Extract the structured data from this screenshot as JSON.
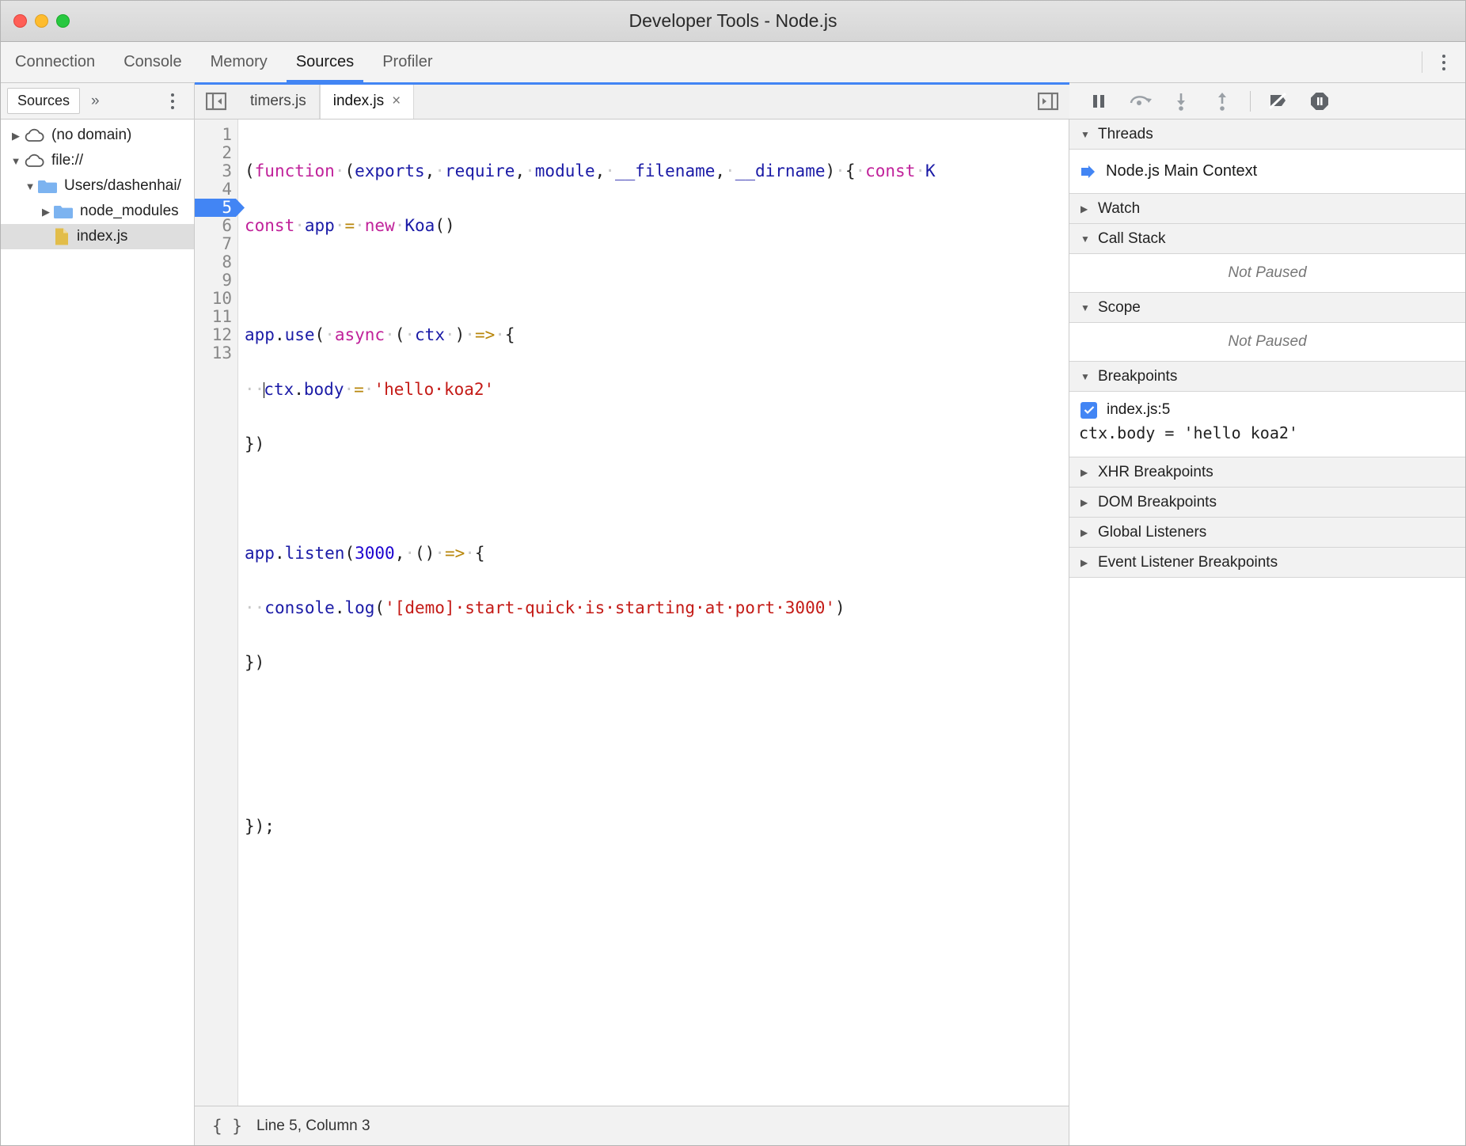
{
  "window": {
    "title": "Developer Tools - Node.js",
    "traffic_lights": [
      "close-red",
      "minimize-yellow",
      "zoom-green"
    ]
  },
  "main_tabs": {
    "items": [
      {
        "label": "Connection",
        "active": false
      },
      {
        "label": "Console",
        "active": false
      },
      {
        "label": "Memory",
        "active": false
      },
      {
        "label": "Sources",
        "active": true
      },
      {
        "label": "Profiler",
        "active": false
      }
    ],
    "more_icon": "kebab-menu-icon"
  },
  "navigator": {
    "tab_label": "Sources",
    "overflow_label": "»",
    "more_icon": "kebab-menu-icon",
    "tree": [
      {
        "label": "(no domain)",
        "icon": "cloud-icon",
        "twisty": "▶",
        "depth": 0,
        "selected": false
      },
      {
        "label": "file://",
        "icon": "cloud-icon",
        "twisty": "▼",
        "depth": 0,
        "selected": false
      },
      {
        "label": "Users/dashenhai/",
        "icon": "folder-icon",
        "twisty": "▼",
        "depth": 1,
        "selected": false
      },
      {
        "label": "node_modules",
        "icon": "folder-icon",
        "twisty": "▶",
        "depth": 2,
        "selected": false
      },
      {
        "label": "index.js",
        "icon": "file-js-icon",
        "twisty": "",
        "depth": 2,
        "selected": true
      }
    ]
  },
  "editor": {
    "show_navigator_icon": "collapse-navigator-icon",
    "show_debugger_icon": "expand-debugger-icon",
    "tabs": [
      {
        "label": "timers.js",
        "active": false,
        "closable": false
      },
      {
        "label": "index.js",
        "active": true,
        "closable": true,
        "close_label": "×"
      }
    ],
    "line_numbers": [
      "1",
      "2",
      "3",
      "4",
      "5",
      "6",
      "7",
      "8",
      "9",
      "10",
      "11",
      "12",
      "13"
    ],
    "breakpoint_line": 5,
    "lines": [
      {
        "n": 1,
        "text": "(function (exports, require, module, __filename, __dirname) { const K"
      },
      {
        "n": 2,
        "text": "const app = new Koa()"
      },
      {
        "n": 3,
        "text": ""
      },
      {
        "n": 4,
        "text": "app.use( async ( ctx ) => {"
      },
      {
        "n": 5,
        "text": "  ctx.body = 'hello koa2'"
      },
      {
        "n": 6,
        "text": "})"
      },
      {
        "n": 7,
        "text": ""
      },
      {
        "n": 8,
        "text": "app.listen(3000, () => {"
      },
      {
        "n": 9,
        "text": "  console.log('[demo] start-quick is starting at port 3000')"
      },
      {
        "n": 10,
        "text": "})"
      },
      {
        "n": 11,
        "text": ""
      },
      {
        "n": 12,
        "text": ""
      },
      {
        "n": 13,
        "text": "});"
      }
    ]
  },
  "status_bar": {
    "format_icon": "pretty-print-braces-icon",
    "position": "Line 5, Column 3"
  },
  "debugger": {
    "toolbar": [
      {
        "name": "resume-pause-icon",
        "label": "Pause script execution"
      },
      {
        "name": "step-over-icon",
        "label": "Step over next function call"
      },
      {
        "name": "step-into-icon",
        "label": "Step into next function call"
      },
      {
        "name": "step-out-icon",
        "label": "Step out of current function"
      },
      {
        "name": "deactivate-breakpoints-icon",
        "label": "Deactivate breakpoints"
      },
      {
        "name": "pause-on-exceptions-icon",
        "label": "Pause on exceptions"
      }
    ],
    "sections": [
      {
        "title": "Threads",
        "expanded": true
      },
      {
        "title": "Watch",
        "expanded": false
      },
      {
        "title": "Call Stack",
        "expanded": true,
        "empty_text": "Not Paused"
      },
      {
        "title": "Scope",
        "expanded": true,
        "empty_text": "Not Paused"
      },
      {
        "title": "Breakpoints",
        "expanded": true
      },
      {
        "title": "XHR Breakpoints",
        "expanded": false
      },
      {
        "title": "DOM Breakpoints",
        "expanded": false
      },
      {
        "title": "Global Listeners",
        "expanded": false
      },
      {
        "title": "Event Listener Breakpoints",
        "expanded": false
      }
    ],
    "threads": [
      {
        "label": "Node.js Main Context",
        "selected": true
      }
    ],
    "call_stack_empty": "Not Paused",
    "scope_empty": "Not Paused",
    "breakpoints": [
      {
        "location": "index.js:5",
        "snippet": "ctx.body = 'hello koa2'",
        "checked": true
      }
    ]
  },
  "colors": {
    "accent": "#4285f4",
    "titlebar": "#dcdcdc",
    "panel_bg": "#f2f2f2",
    "keyword": "#c0219a",
    "identifier": "#1a1aa6",
    "string": "#c41a16",
    "number": "#1c00cf",
    "operator": "#b8860b",
    "folder": "#7cb3f0",
    "js_file": "#e2bd4a"
  }
}
